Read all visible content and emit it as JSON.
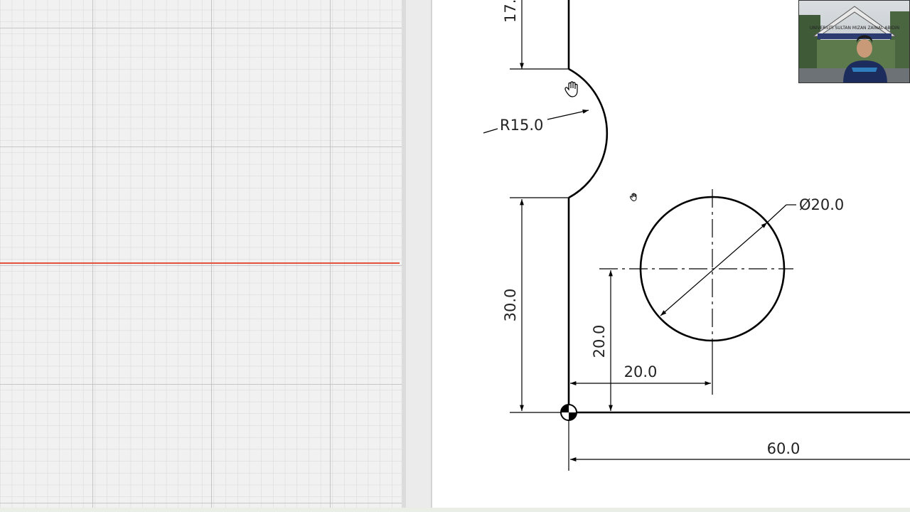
{
  "drawing": {
    "dims": {
      "top_partial": "17.",
      "radius": "R15.0",
      "diameter": "Ø20.0",
      "left_height": "30.0",
      "hole_vertical": "20.0",
      "hole_horizontal": "20.0",
      "overall_width": "60.0"
    }
  },
  "webcam": {
    "sign_text": "UNIVERSITI SULTAN MIZAN ZAINAL ABIDIN"
  },
  "colors": {
    "grid_bg": "#f1f1f1",
    "grid_minor": "#d6d6d6",
    "grid_major": "#b9b9b9",
    "axis_red": "#e3523b",
    "line": "#000000"
  },
  "icons": [
    "hand-cursor-icon",
    "small-hand-cursor-icon",
    "origin-marker-icon"
  ]
}
